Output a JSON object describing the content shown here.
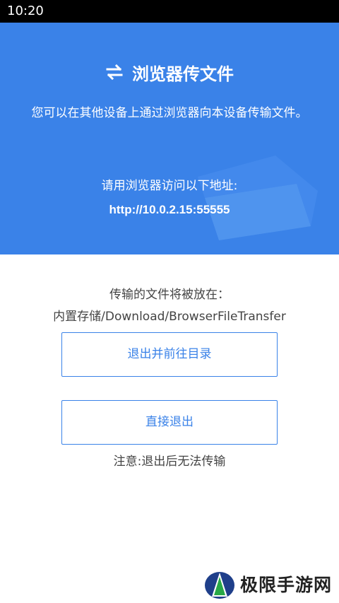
{
  "status_bar": {
    "time": "10:20"
  },
  "hero": {
    "title": "浏览器传文件",
    "description": "您可以在其他设备上通过浏览器向本设备传输文件。",
    "visit_label": "请用浏览器访问以下地址:",
    "url": "http://10.0.2.15:55555",
    "title_icon": "transfer-arrows-icon",
    "background_color": "#3a82e8"
  },
  "save_location": {
    "label": "传输的文件将被放在：",
    "path": "内置存储/Download/BrowserFileTransfer"
  },
  "actions": {
    "exit_and_open_dir": "退出并前往目录",
    "exit": "直接退出",
    "accent_color": "#3a82e8"
  },
  "notice": "注意:退出后无法传输",
  "watermark": {
    "text": "极限手游网"
  }
}
